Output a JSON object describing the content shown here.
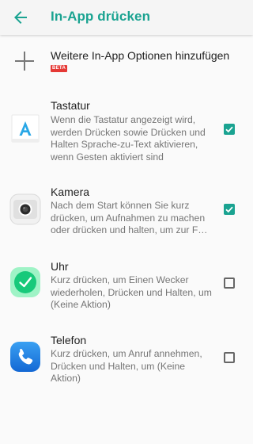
{
  "header": {
    "title": "In-App drücken",
    "back_icon": "arrow-back-icon"
  },
  "add_option": {
    "label": "Weitere In-App Optionen hinzufügen",
    "badge": "BETA",
    "icon": "plus-icon"
  },
  "items": [
    {
      "title": "Tastatur",
      "description": "Wenn die Tastatur angezeigt wird, werden Drücken sowie Drücken und Halten Sprache-zu-Text aktivieren, wenn Gesten aktiviert sind",
      "icon": "keyboard-app-icon",
      "checked": true
    },
    {
      "title": "Kamera",
      "description": "Nach dem Start können Sie kurz drücken, um Aufnahmen zu machen oder drücken und halten, um zur F…",
      "icon": "camera-app-icon",
      "checked": true
    },
    {
      "title": "Uhr",
      "description": "Kurz drücken, um Einen Wecker wiederholen, Drücken und Halten, um (Keine Aktion)",
      "icon": "clock-app-icon",
      "checked": false
    },
    {
      "title": "Telefon",
      "description": "Kurz drücken, um Anruf annehmen, Drücken und Halten, um (Keine Aktion)",
      "icon": "phone-app-icon",
      "checked": false
    }
  ],
  "colors": {
    "accent": "#1aa391",
    "badge": "#e53935",
    "title_text": "#212121",
    "secondary_text": "#757575"
  }
}
